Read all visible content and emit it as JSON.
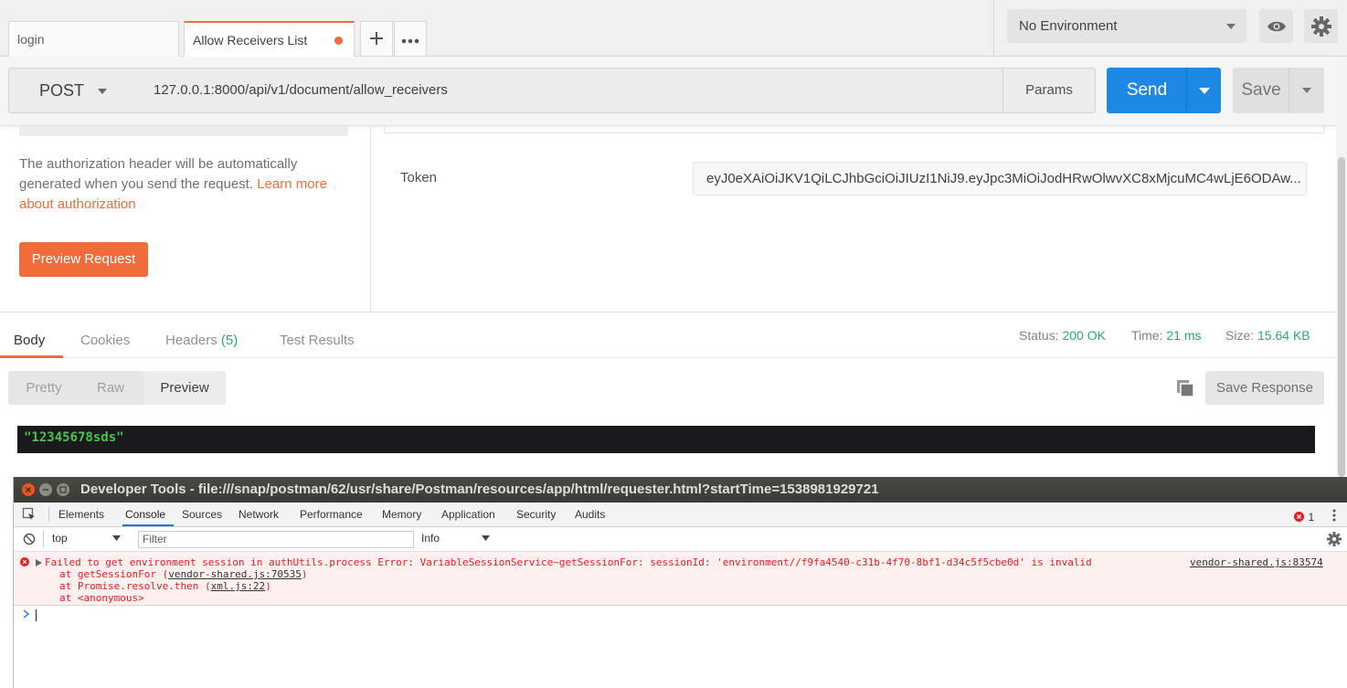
{
  "tabs": [
    {
      "label": "login"
    },
    {
      "label": "Allow Receivers List"
    }
  ],
  "env": {
    "selected": "No Environment"
  },
  "request": {
    "method": "POST",
    "url": "127.0.0.1:8000/api/v1/document/allow_receivers",
    "params_label": "Params",
    "send_label": "Send",
    "save_label": "Save"
  },
  "auth": {
    "text": "The authorization header will be automatically generated when you send the request.",
    "link": "Learn more about authorization",
    "preview_button": "Preview Request",
    "token_label": "Token",
    "token_value": "eyJ0eXAiOiJKV1QiLCJhbGciOiJIUzI1NiJ9.eyJpc3MiOiJodHRwOlwvXC8xMjcuMC4wLjE6ODAw..."
  },
  "response": {
    "tabs": [
      "Body",
      "Cookies",
      "Headers",
      "Test Results"
    ],
    "headers_count": "(5)",
    "status_label": "Status:",
    "status_value": "200 OK",
    "time_label": "Time:",
    "time_value": "21 ms",
    "size_label": "Size:",
    "size_value": "15.64 KB",
    "formats": [
      "Pretty",
      "Raw",
      "Preview"
    ],
    "save_response": "Save Response",
    "body": "\"12345678sds\""
  },
  "devtools": {
    "title": "Developer Tools - file:///snap/postman/62/usr/share/Postman/resources/app/html/requester.html?startTime=1538981929721",
    "tabs": [
      "Elements",
      "Console",
      "Sources",
      "Network",
      "Performance",
      "Memory",
      "Application",
      "Security",
      "Audits"
    ],
    "error_count": "1",
    "context": "top",
    "filter_placeholder": "Filter",
    "level": "Info",
    "error": {
      "message": "Failed to get environment session in authUtils.process Error: VariableSessionService~getSessionFor: sessionId: 'environment//f9fa4540-c31b-4f70-8bf1-d34c5f5cbe0d' is invalid",
      "source": "vendor-shared.js:83574",
      "stack1_prefix": "at getSessionFor (",
      "stack1_link": "vendor-shared.js:70535",
      "stack2_prefix": "at Promise.resolve.then (",
      "stack2_link": "xml.js:22",
      "stack3": "at <anonymous>",
      "close_paren": ")"
    }
  },
  "colors": {
    "accent": "#f26b3a",
    "send": "#1e88e5",
    "status_ok": "#27ae60",
    "error": "#e41e1e"
  }
}
